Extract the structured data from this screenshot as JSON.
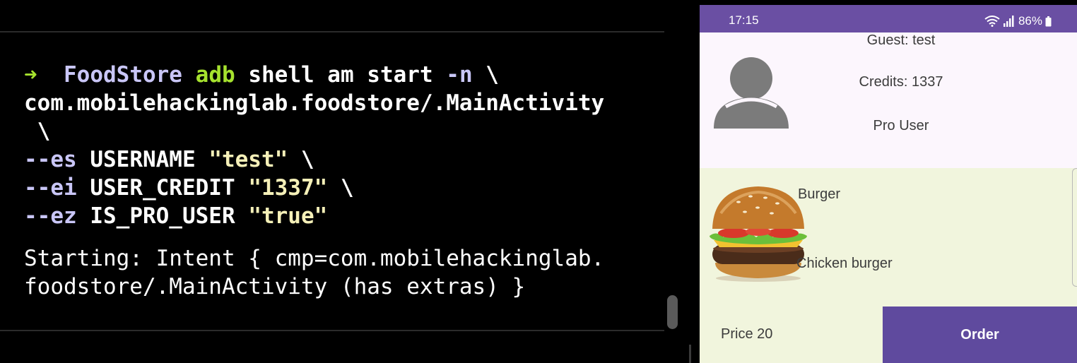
{
  "terminal": {
    "prompt_arrow": "➜",
    "cwd": "FoodStore",
    "cmd": "adb",
    "cmd_args": "shell am start",
    "flag_n": "-n",
    "line_cont": "\\",
    "component": "com.mobilehackinglab.foodstore/.MainActivity",
    "cont_line": " \\",
    "extras": [
      {
        "flag": "--es",
        "key": "USERNAME",
        "value": "\"test\"",
        "cont": "\\"
      },
      {
        "flag": "--ei",
        "key": "USER_CREDIT",
        "value": "\"1337\"",
        "cont": "\\"
      },
      {
        "flag": "--ez",
        "key": "IS_PRO_USER",
        "value": "\"true\"",
        "cont": ""
      }
    ],
    "output": [
      "Starting: Intent { cmp=com.mobilehackinglab.",
      "foodstore/.MainActivity (has extras) }"
    ]
  },
  "phone": {
    "status_bar": {
      "time": "17:15",
      "battery": "86%",
      "icons": [
        "wifi-icon",
        "signal-icon",
        "battery-icon"
      ],
      "bg_color": "#6a4fa3"
    },
    "header": {
      "guest": "Guest: test",
      "credits": "Credits: 1337",
      "user_type": "Pro User"
    },
    "food_item": {
      "name": "Burger",
      "description": "Chicken burger",
      "image": "burger-image"
    },
    "footer": {
      "price": "Price 20",
      "order_label": "Order",
      "order_color": "#5f4a9e"
    }
  }
}
